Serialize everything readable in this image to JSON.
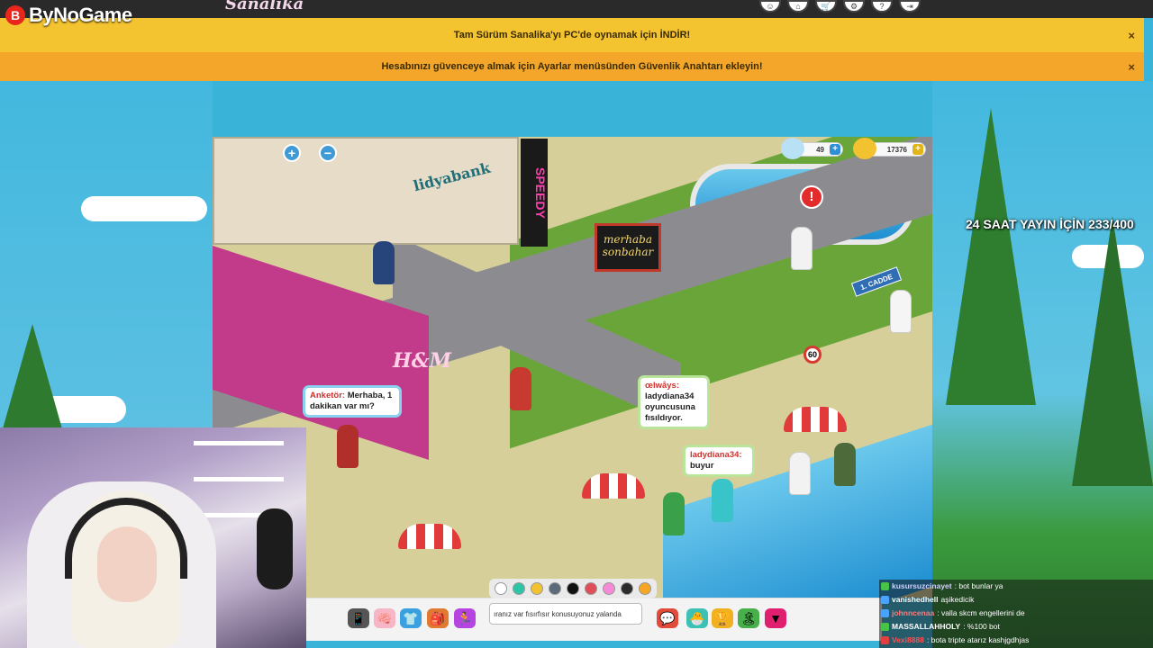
{
  "brand": {
    "logo_letter": "B",
    "name": "ByNoGame"
  },
  "game_logo": "Sanalika",
  "top_icons": [
    {
      "name": "profile-icon",
      "glyph": "☺"
    },
    {
      "name": "home-icon",
      "glyph": "⌂"
    },
    {
      "name": "cart-icon",
      "glyph": "🛒"
    },
    {
      "name": "gear-icon",
      "glyph": "⚙"
    },
    {
      "name": "help-icon",
      "glyph": "?"
    },
    {
      "name": "exit-icon",
      "glyph": "⇥"
    }
  ],
  "banners": {
    "download": {
      "text": "Tam Sürüm Sanalika'yı PC'de oynamak için İNDİR!",
      "close": "×"
    },
    "security": {
      "text": "Hesabınızı güvenceye almak için Ayarlar menüsünden Güvenlik Anahtarı ekleyin!",
      "close": "×"
    }
  },
  "stream_overlay": {
    "text": "24 SAAT YAYIN İÇİN 233/400"
  },
  "hud": {
    "zoom_in": "+",
    "zoom_out": "−",
    "gems": {
      "value": "49",
      "plus": "+"
    },
    "coins": {
      "value": "17376",
      "plus": "+"
    },
    "alert": "!"
  },
  "scene": {
    "bank_sign": "lidyabank",
    "speedy_sign": "SPEEDY",
    "merkaba_sign": "merhaba sonbahar",
    "speed_sign": "60",
    "street_sign": "1. CADDE",
    "hm_sign": "H&M"
  },
  "bubbles": {
    "anketor": {
      "name": "Anketör:",
      "text": "Merhaba, 1 dakikan var mı?"
    },
    "whisper": {
      "name": "œlwåys:",
      "text": "ladydiana34 oyuncusuna fısıldıyor."
    },
    "lady": {
      "name": "ladydiana34:",
      "text": "buyur"
    }
  },
  "chat_colors": [
    "#ffffff",
    "#2ec4a6",
    "#f2c230",
    "#5b6b7a",
    "#111111",
    "#e04e5a",
    "#f58ad7",
    "#2b2b2b",
    "#f5a623"
  ],
  "chat_input": {
    "value": "ıranız var fısırfısır konusuyonuz yalanda"
  },
  "toolbar": [
    {
      "name": "phone-icon",
      "glyph": "📱",
      "bg": "#555555"
    },
    {
      "name": "brain-icon",
      "glyph": "🧠",
      "bg": "#f6b6c6"
    },
    {
      "name": "outfit-icon",
      "glyph": "👕",
      "bg": "#3aa0e0"
    },
    {
      "name": "backpack-icon",
      "glyph": "🎒",
      "bg": "#e07a2e"
    },
    {
      "name": "dance-icon",
      "glyph": "🏃",
      "bg": "#b544e0"
    },
    {
      "name": "chat-bubble-icon",
      "glyph": "💬",
      "bg": "#e24a3a"
    },
    {
      "name": "pet-icon",
      "glyph": "🐣",
      "bg": "#3ec1b5"
    },
    {
      "name": "trophy-icon",
      "glyph": "🏆",
      "bg": "#f0b020"
    },
    {
      "name": "island-icon",
      "glyph": "🏝",
      "bg": "#48b04a"
    },
    {
      "name": "menu-triangle-icon",
      "glyph": "▼",
      "bg": "#e0206f"
    }
  ],
  "stream_chat": [
    {
      "user": "kusursuzcinayet",
      "msg": ": bot bunlar ya",
      "badge": "#47c447",
      "user_color": "#d0d0ff"
    },
    {
      "user": "vanishedhell",
      "msg": "aşikedicik",
      "badge": "#4aa3ff",
      "user_color": "#ffffff"
    },
    {
      "user": "johnncenaa",
      "msg": ": valla skcm engellerini de",
      "badge": "#4aa3ff",
      "user_color": "#ff7a7a"
    },
    {
      "user": "MASSALLAHHOLY",
      "msg": ": %100 bot",
      "badge": "#47c447",
      "user_color": "#ffffff"
    },
    {
      "user": "Vexi8888",
      "msg": ": bota tripte atarız kashjgdhjas",
      "badge": "#e04040",
      "user_color": "#ff5050"
    }
  ]
}
